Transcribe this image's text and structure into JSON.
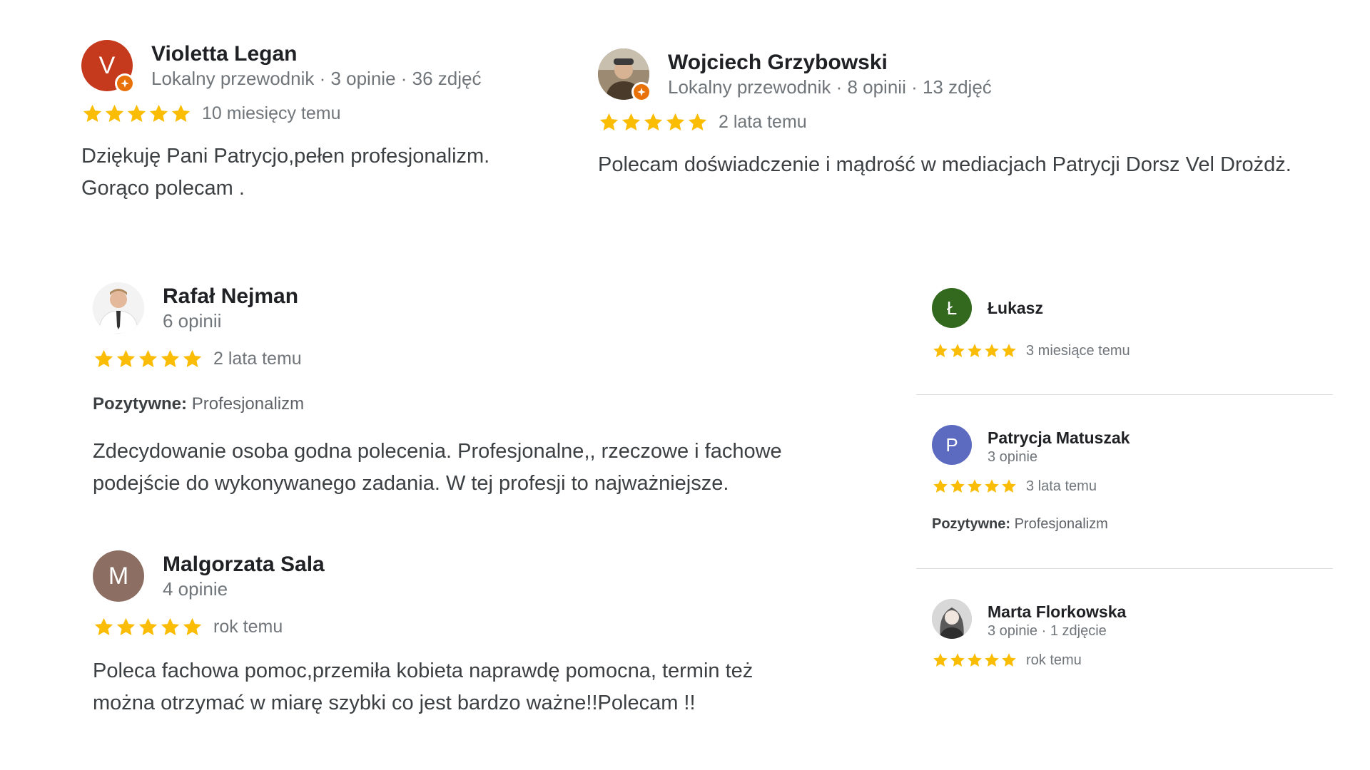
{
  "colors": {
    "star": "#fbbc04",
    "text": "#202124",
    "secondary": "#70757a",
    "divider": "#dadce0",
    "guide_badge": "#e8710a"
  },
  "reviews": [
    {
      "name": "Violetta Legan",
      "meta": "Lokalny przewodnik · 3 opinie · 36 zdjęć",
      "avatar_letter": "V",
      "avatar_color": "#c5391c",
      "rating": 5,
      "time": "10 miesięcy temu",
      "text_lines": [
        "Dziękuję Pani Patrycjo,pełen profesjonalizm.",
        "Gorąco polecam ."
      ]
    },
    {
      "name": "Wojciech Grzybowski",
      "meta": "Lokalny przewodnik · 8 opinii · 13 zdjęć",
      "avatar_icon": "user-photo",
      "rating": 5,
      "time": "2 lata temu",
      "text_lines": [
        "Polecam doświadczenie i mądrość w mediacjach Patrycji Dorsz Vel Drożdż."
      ]
    },
    {
      "name": "Rafał Nejman",
      "meta": "6 opinii",
      "avatar_icon": "user-photo",
      "rating": 5,
      "time": "2 lata temu",
      "pros_label": "Pozytywne:",
      "pros_value": "Profesjonalizm",
      "text_lines": [
        "Zdecydowanie osoba godna polecenia. Profesjonalne,, rzeczowe i fachowe",
        "podejście do wykonywanego zadania. W tej profesji to najważniejsze."
      ]
    },
    {
      "name": "Malgorzata Sala",
      "meta": "4 opinie",
      "avatar_letter": "M",
      "avatar_color": "#8d6e63",
      "rating": 5,
      "time": "rok temu",
      "text_lines": [
        "Poleca fachowa pomoc,przemiła kobieta naprawdę pomocna, termin też",
        "można otrzymać w miarę szybki co jest bardzo ważne!!Polecam !!"
      ]
    },
    {
      "name": "Łukasz",
      "avatar_letter": "Ł",
      "avatar_color": "#33691e",
      "rating": 5,
      "time": "3 miesiące temu"
    },
    {
      "name": "Patrycja Matuszak",
      "meta": "3 opinie",
      "avatar_letter": "P",
      "avatar_color": "#5c6bc0",
      "rating": 5,
      "time": "3 lata temu",
      "pros_label": "Pozytywne:",
      "pros_value": "Profesjonalizm"
    },
    {
      "name": "Marta Florkowska",
      "meta": "3 opinie · 1 zdjęcie",
      "avatar_icon": "user-photo",
      "rating": 5,
      "time": "rok temu"
    }
  ]
}
